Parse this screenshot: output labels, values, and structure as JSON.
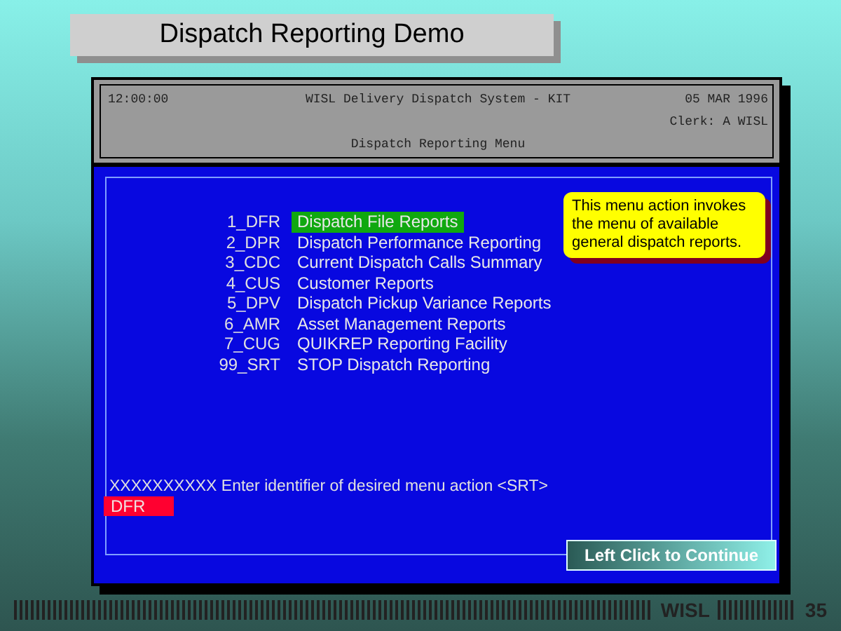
{
  "slide_title": "Dispatch Reporting Demo",
  "header": {
    "time": "12:00:00",
    "system_title": "WISL Delivery Dispatch System - KIT",
    "date": "05 MAR 1996",
    "clerk": "Clerk:  A WISL",
    "menu_title": "Dispatch Reporting Menu"
  },
  "menu_items": [
    {
      "code": "1_DFR",
      "label": "Dispatch File Reports",
      "selected": true
    },
    {
      "code": "2_DPR",
      "label": "Dispatch Performance Reporting",
      "selected": false
    },
    {
      "code": "3_CDC",
      "label": "Current Dispatch Calls Summary",
      "selected": false
    },
    {
      "code": "4_CUS",
      "label": "Customer Reports",
      "selected": false
    },
    {
      "code": "5_DPV",
      "label": "Dispatch Pickup Variance Reports",
      "selected": false
    },
    {
      "code": "6_AMR",
      "label": "Asset Management Reports",
      "selected": false
    },
    {
      "code": "7_CUG",
      "label": "QUIKREP Reporting Facility",
      "selected": false
    },
    {
      "code": "99_SRT",
      "label": "STOP Dispatch Reporting",
      "selected": false
    }
  ],
  "tooltip": "This menu action invokes the menu of available general dispatch reports.",
  "prompt": "XXXXXXXXXX Enter identifier of desired menu action <SRT>",
  "input": {
    "value": "DFR"
  },
  "continue_button": "Left Click to Continue",
  "footer": {
    "brand": "WISL",
    "page": "35"
  }
}
